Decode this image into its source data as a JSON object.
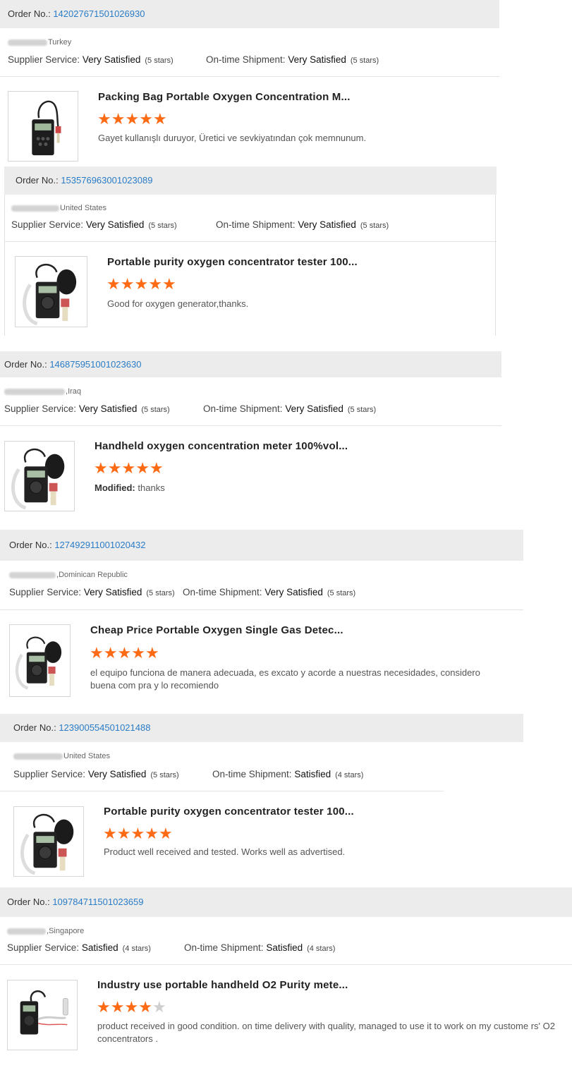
{
  "reviews": [
    {
      "order_label": "Order No.:",
      "order_number": "142027671501026930",
      "country": "Turkey",
      "supplier_label": "Supplier Service:",
      "supplier_value": "Very Satisfied",
      "supplier_stars": "(5 stars)",
      "shipment_label": "On-time Shipment:",
      "shipment_value": "Very Satisfied",
      "shipment_stars": "(5 stars)",
      "product_title": "Packing Bag Portable Oxygen Concentration M...",
      "rating": 5,
      "comment_prefix": "",
      "comment": "Gayet kullanışlı duruyor, Üretici ve sevkiyatından çok memnunum."
    },
    {
      "order_label": "Order No.:",
      "order_number": "153576963001023089",
      "country": "United States",
      "supplier_label": "Supplier Service:",
      "supplier_value": "Very Satisfied",
      "supplier_stars": "(5 stars)",
      "shipment_label": "On-time Shipment:",
      "shipment_value": "Very Satisfied",
      "shipment_stars": "(5 stars)",
      "product_title": "Portable purity oxygen concentrator tester 100...",
      "rating": 5,
      "comment_prefix": "",
      "comment": "Good for oxygen generator,thanks."
    },
    {
      "order_label": "Order No.:",
      "order_number": "146875951001023630",
      "country": "Iraq",
      "supplier_label": "Supplier Service:",
      "supplier_value": "Very Satisfied",
      "supplier_stars": "(5 stars)",
      "shipment_label": "On-time Shipment:",
      "shipment_value": "Very Satisfied",
      "shipment_stars": "(5 stars)",
      "product_title": "Handheld oxygen concentration meter 100%vol...",
      "rating": 5,
      "comment_prefix": "Modified:",
      "comment": "thanks"
    },
    {
      "order_label": "Order No.:",
      "order_number": "127492911001020432",
      "country": "Dominican Republic",
      "supplier_label": "Supplier Service:",
      "supplier_value": "Very Satisfied",
      "supplier_stars": "(5 stars)",
      "shipment_label": "On-time Shipment:",
      "shipment_value": "Very Satisfied",
      "shipment_stars": "(5 stars)",
      "product_title": "Cheap Price Portable Oxygen Single Gas Detec...",
      "rating": 5,
      "comment_prefix": "",
      "comment": "el equipo funciona de manera adecuada, es excato y acorde a nuestras necesidades, considero buena com pra y lo recomiendo"
    },
    {
      "order_label": "Order No.:",
      "order_number": "123900554501021488",
      "country": "United States",
      "supplier_label": "Supplier Service:",
      "supplier_value": "Very Satisfied",
      "supplier_stars": "(5 stars)",
      "shipment_label": "On-time Shipment:",
      "shipment_value": "Satisfied",
      "shipment_stars": "(4 stars)",
      "product_title": "Portable purity oxygen concentrator tester 100...",
      "rating": 5,
      "comment_prefix": "",
      "comment": "Product well received and tested.  Works well as advertised."
    },
    {
      "order_label": "Order No.:",
      "order_number": "109784711501023659",
      "country": "Singapore",
      "supplier_label": "Supplier Service:",
      "supplier_value": "Satisfied",
      "supplier_stars": "(4 stars)",
      "shipment_label": "On-time Shipment:",
      "shipment_value": "Satisfied",
      "shipment_stars": "(4 stars)",
      "product_title": "Industry use portable handheld O2 Purity mete...",
      "rating": 4,
      "comment_prefix": "",
      "comment": "product received in good condition. on time delivery with quality, managed to use it to work on my custome rs' O2 concentrators ."
    }
  ],
  "colors": {
    "star_on": "#ff6a14",
    "star_off": "#cfcfcf",
    "order_link": "#2a7cc7",
    "order_bar_bg": "#ececec"
  },
  "icons": [
    "oxygen-meter-icon",
    "star-icon"
  ]
}
